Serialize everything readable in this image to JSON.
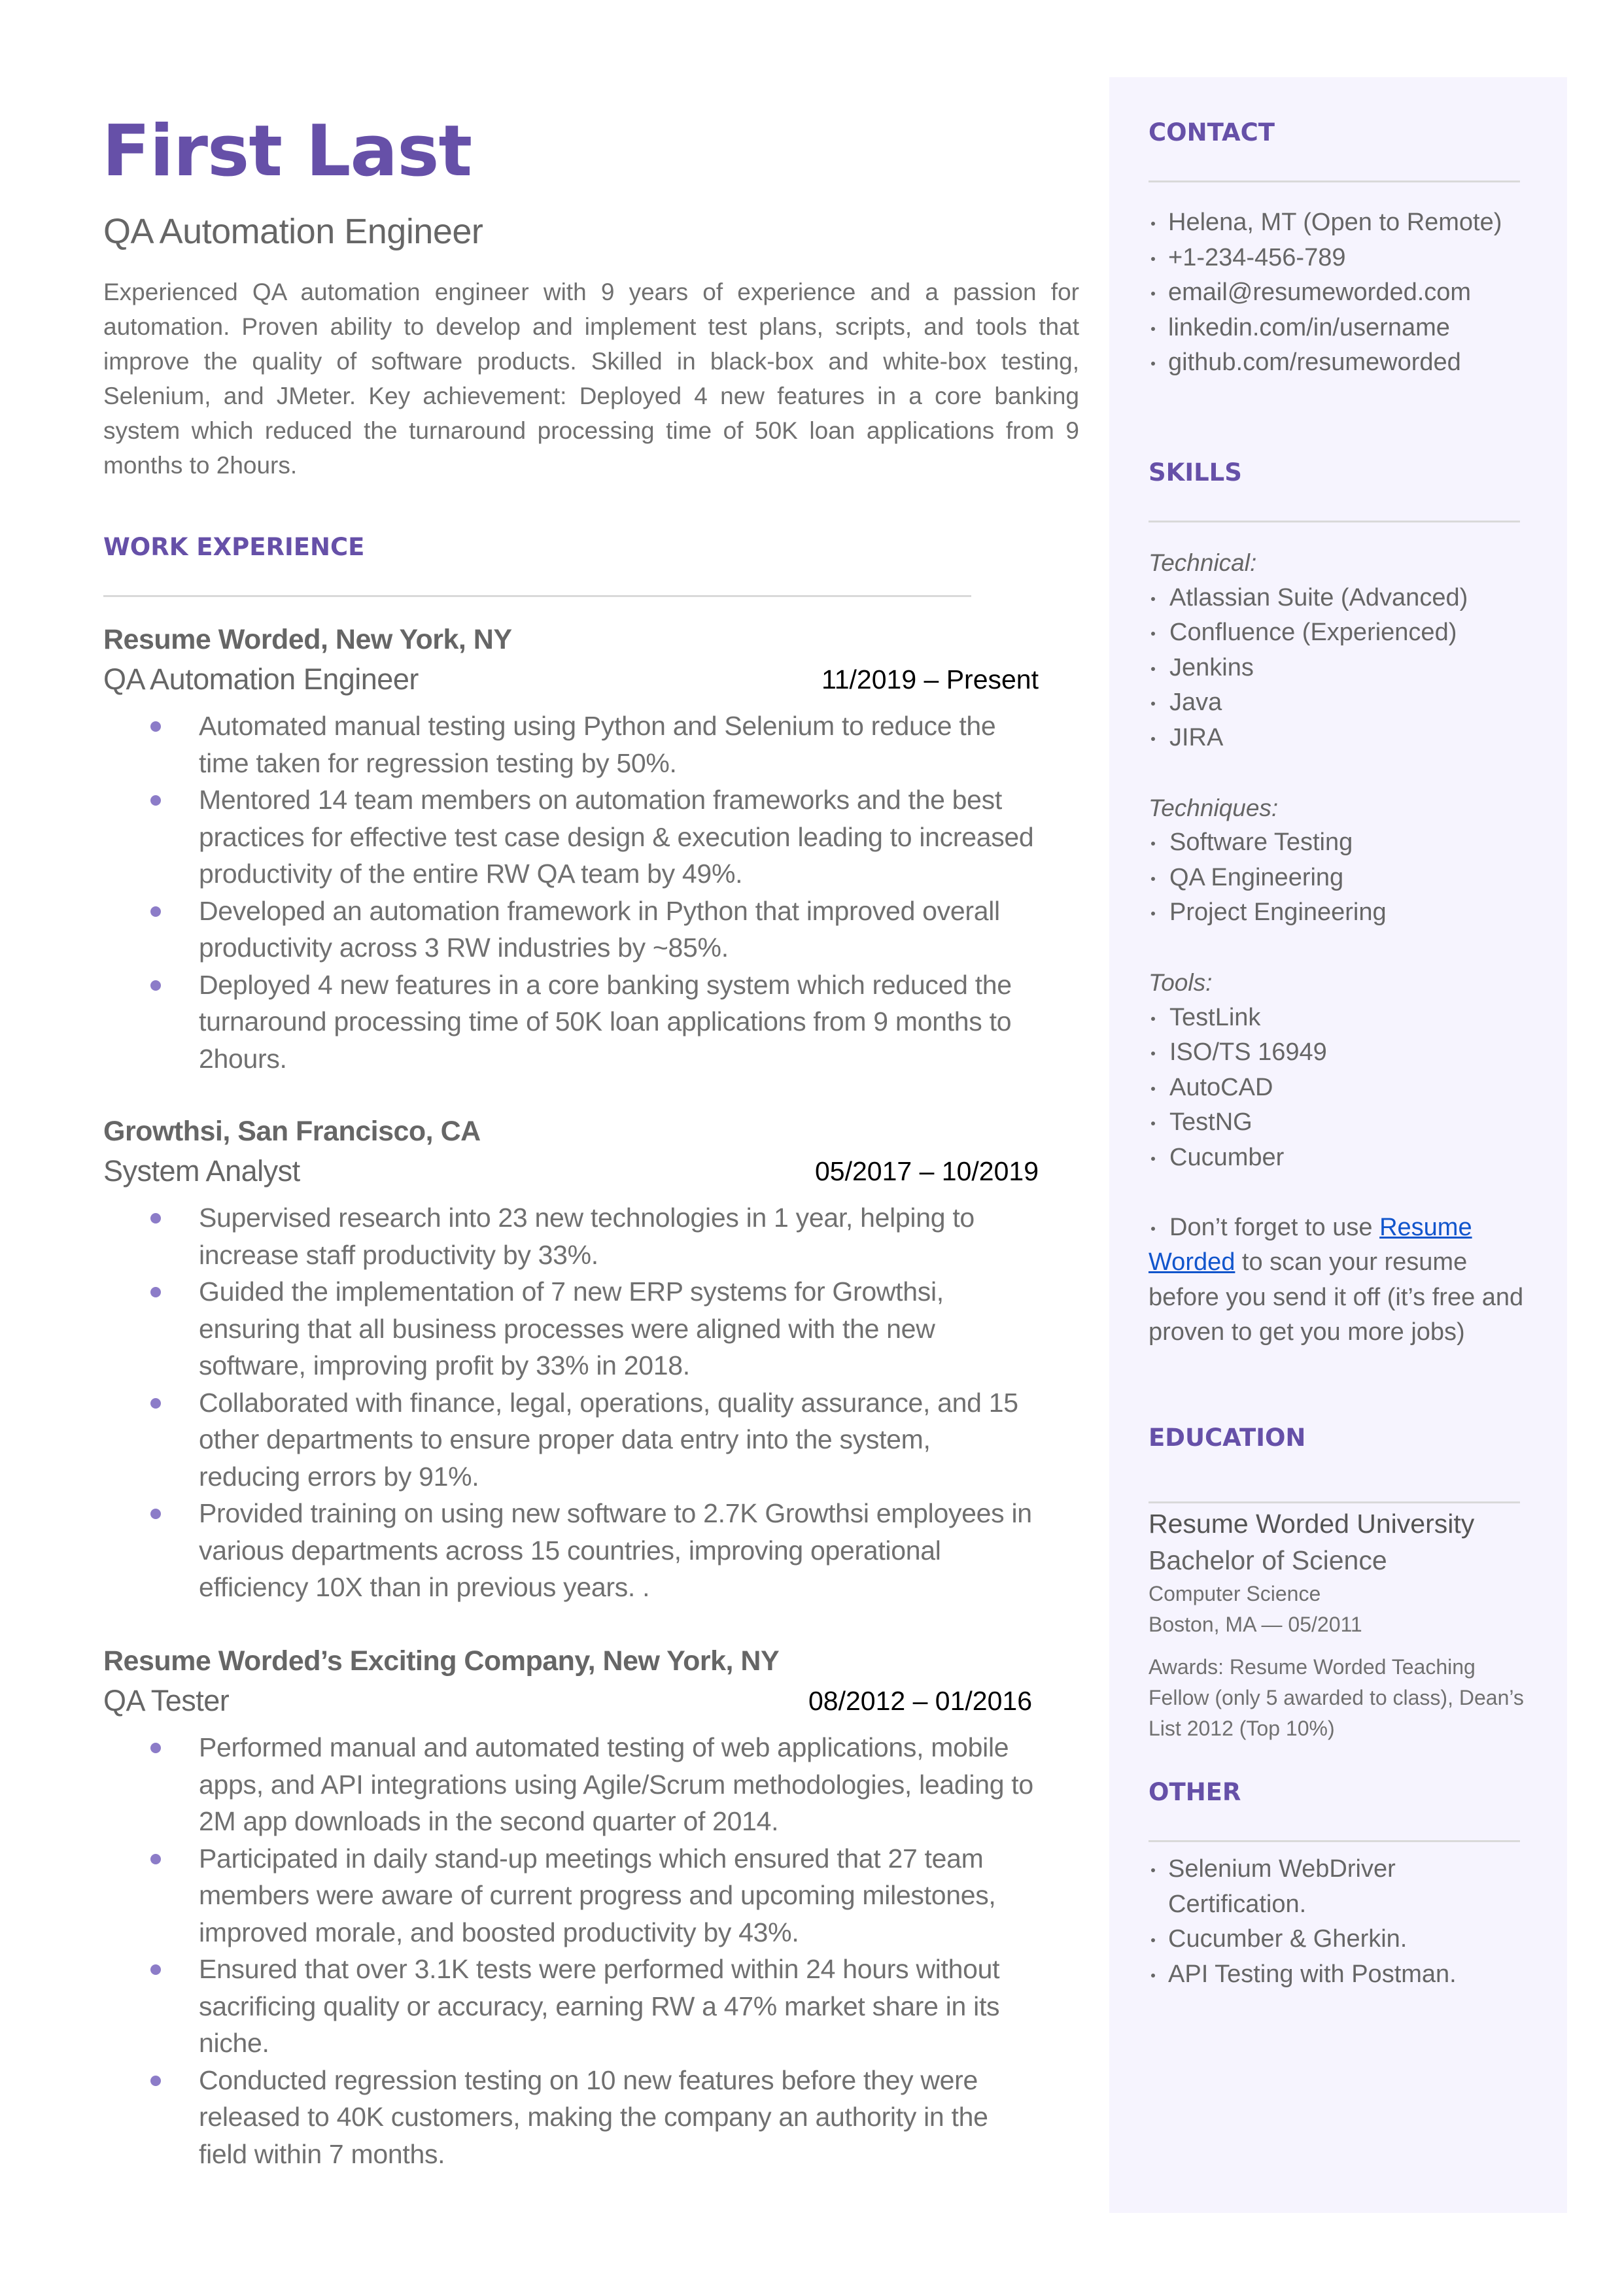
{
  "header": {
    "name": "First Last",
    "title": "QA Automation Engineer",
    "summary": "Experienced QA automation engineer with 9 years of experience and a passion for automation. Proven ability to develop and implement test plans, scripts, and tools that improve the quality of software products. Skilled in black-box and white-box testing, Selenium, and JMeter. Key achievement: Deployed 4 new features in a core banking system which reduced the turnaround processing time of 50K loan applications from 9 months to 2hours."
  },
  "work_experience": {
    "heading": "WORK EXPERIENCE",
    "jobs": [
      {
        "company": "Resume Worded, New York, NY",
        "role": "QA Automation Engineer",
        "dates": "11/2019 – Present",
        "bullets": [
          "Automated manual testing using Python and Selenium to reduce the time taken for regression testing by 50%.",
          "Mentored 14 team members on automation frameworks and the best practices for effective test case design & execution leading to increased productivity of the entire RW QA team by 49%.",
          "Developed an automation framework in Python that improved overall productivity across 3 RW industries by ~85%.",
          "Deployed 4 new features in a core banking system which reduced the turnaround processing time of 50K loan applications from 9 months to 2hours."
        ]
      },
      {
        "company": "Growthsi, San Francisco, CA",
        "role": "System Analyst",
        "dates": "05/2017 – 10/2019",
        "bullets": [
          "Supervised research into 23 new technologies in 1 year, helping to increase staff productivity by 33%.",
          "Guided the implementation of 7 new ERP systems for Growthsi, ensuring that all business processes were aligned with the new software, improving profit by 33% in 2018.",
          "Collaborated with finance, legal, operations, quality assurance, and 15 other departments to ensure proper data entry into the system, reducing errors by 91%.",
          "Provided training on using new software to 2.7K Growthsi employees in various departments across 15 countries, improving operational efficiency 10X than in previous years. ."
        ]
      },
      {
        "company": "Resume Worded’s Exciting Company, New York, NY",
        "role": "QA Tester",
        "dates": "08/2012 – 01/2016",
        "bullets": [
          "Performed manual and automated testing of web applications, mobile apps, and API integrations using Agile/Scrum methodologies, leading to 2M app downloads in the second quarter of 2014.",
          "Participated in daily stand-up meetings which ensured that 27 team members were aware of current progress and upcoming milestones, improved morale, and boosted productivity by 43%.",
          "Ensured that over 3.1K tests were performed within 24 hours without sacrificing quality or accuracy, earning RW a 47% market share in its niche.",
          "Conducted regression testing on 10 new features before they were released to 40K customers, making the company an authority in the field within 7 months."
        ]
      }
    ]
  },
  "sidebar": {
    "contact": {
      "heading": "CONTACT",
      "items": [
        " Helena, MT (Open to Remote)",
        "+1-234-456-789",
        "email@resumeworded.com",
        "linkedin.com/in/username",
        "github.com/resumeworded"
      ]
    },
    "skills": {
      "heading": "SKILLS",
      "groups": [
        {
          "label": "Technical:",
          "items": [
            "Atlassian Suite (Advanced)",
            "Confluence (Experienced)",
            "Jenkins",
            "Java",
            "JIRA"
          ]
        },
        {
          "label": "Techniques:",
          "items": [
            "Software Testing",
            "QA Engineering",
            "Project Engineering"
          ]
        },
        {
          "label": "Tools:",
          "items": [
            "TestLink",
            "ISO/TS 16949",
            "AutoCAD",
            "TestNG",
            "Cucumber"
          ]
        }
      ],
      "note": {
        "prefix": "Don’t forget to use ",
        "link_text": "Resume Worded",
        "suffix": " to scan your resume before you send it off (it’s free and proven to get you more jobs)"
      }
    },
    "education": {
      "heading": "EDUCATION",
      "school": "Resume Worded University",
      "degree": "Bachelor of Science",
      "field": "Computer Science",
      "location_date": "Boston, MA — 05/2011",
      "awards": "Awards: Resume Worded Teaching Fellow (only 5 awarded to class), Dean’s List 2012 (Top 10%)"
    },
    "other": {
      "heading": "OTHER",
      "items": [
        "Selenium WebDriver Certification.",
        "Cucumber & Gherkin.",
        "API Testing with Postman."
      ]
    }
  },
  "colors": {
    "accent": "#6650A8",
    "bullet": "#8C7CC8",
    "sidebar_bg": "#F6F4FE",
    "link": "#1155CC",
    "text": "#666666"
  }
}
